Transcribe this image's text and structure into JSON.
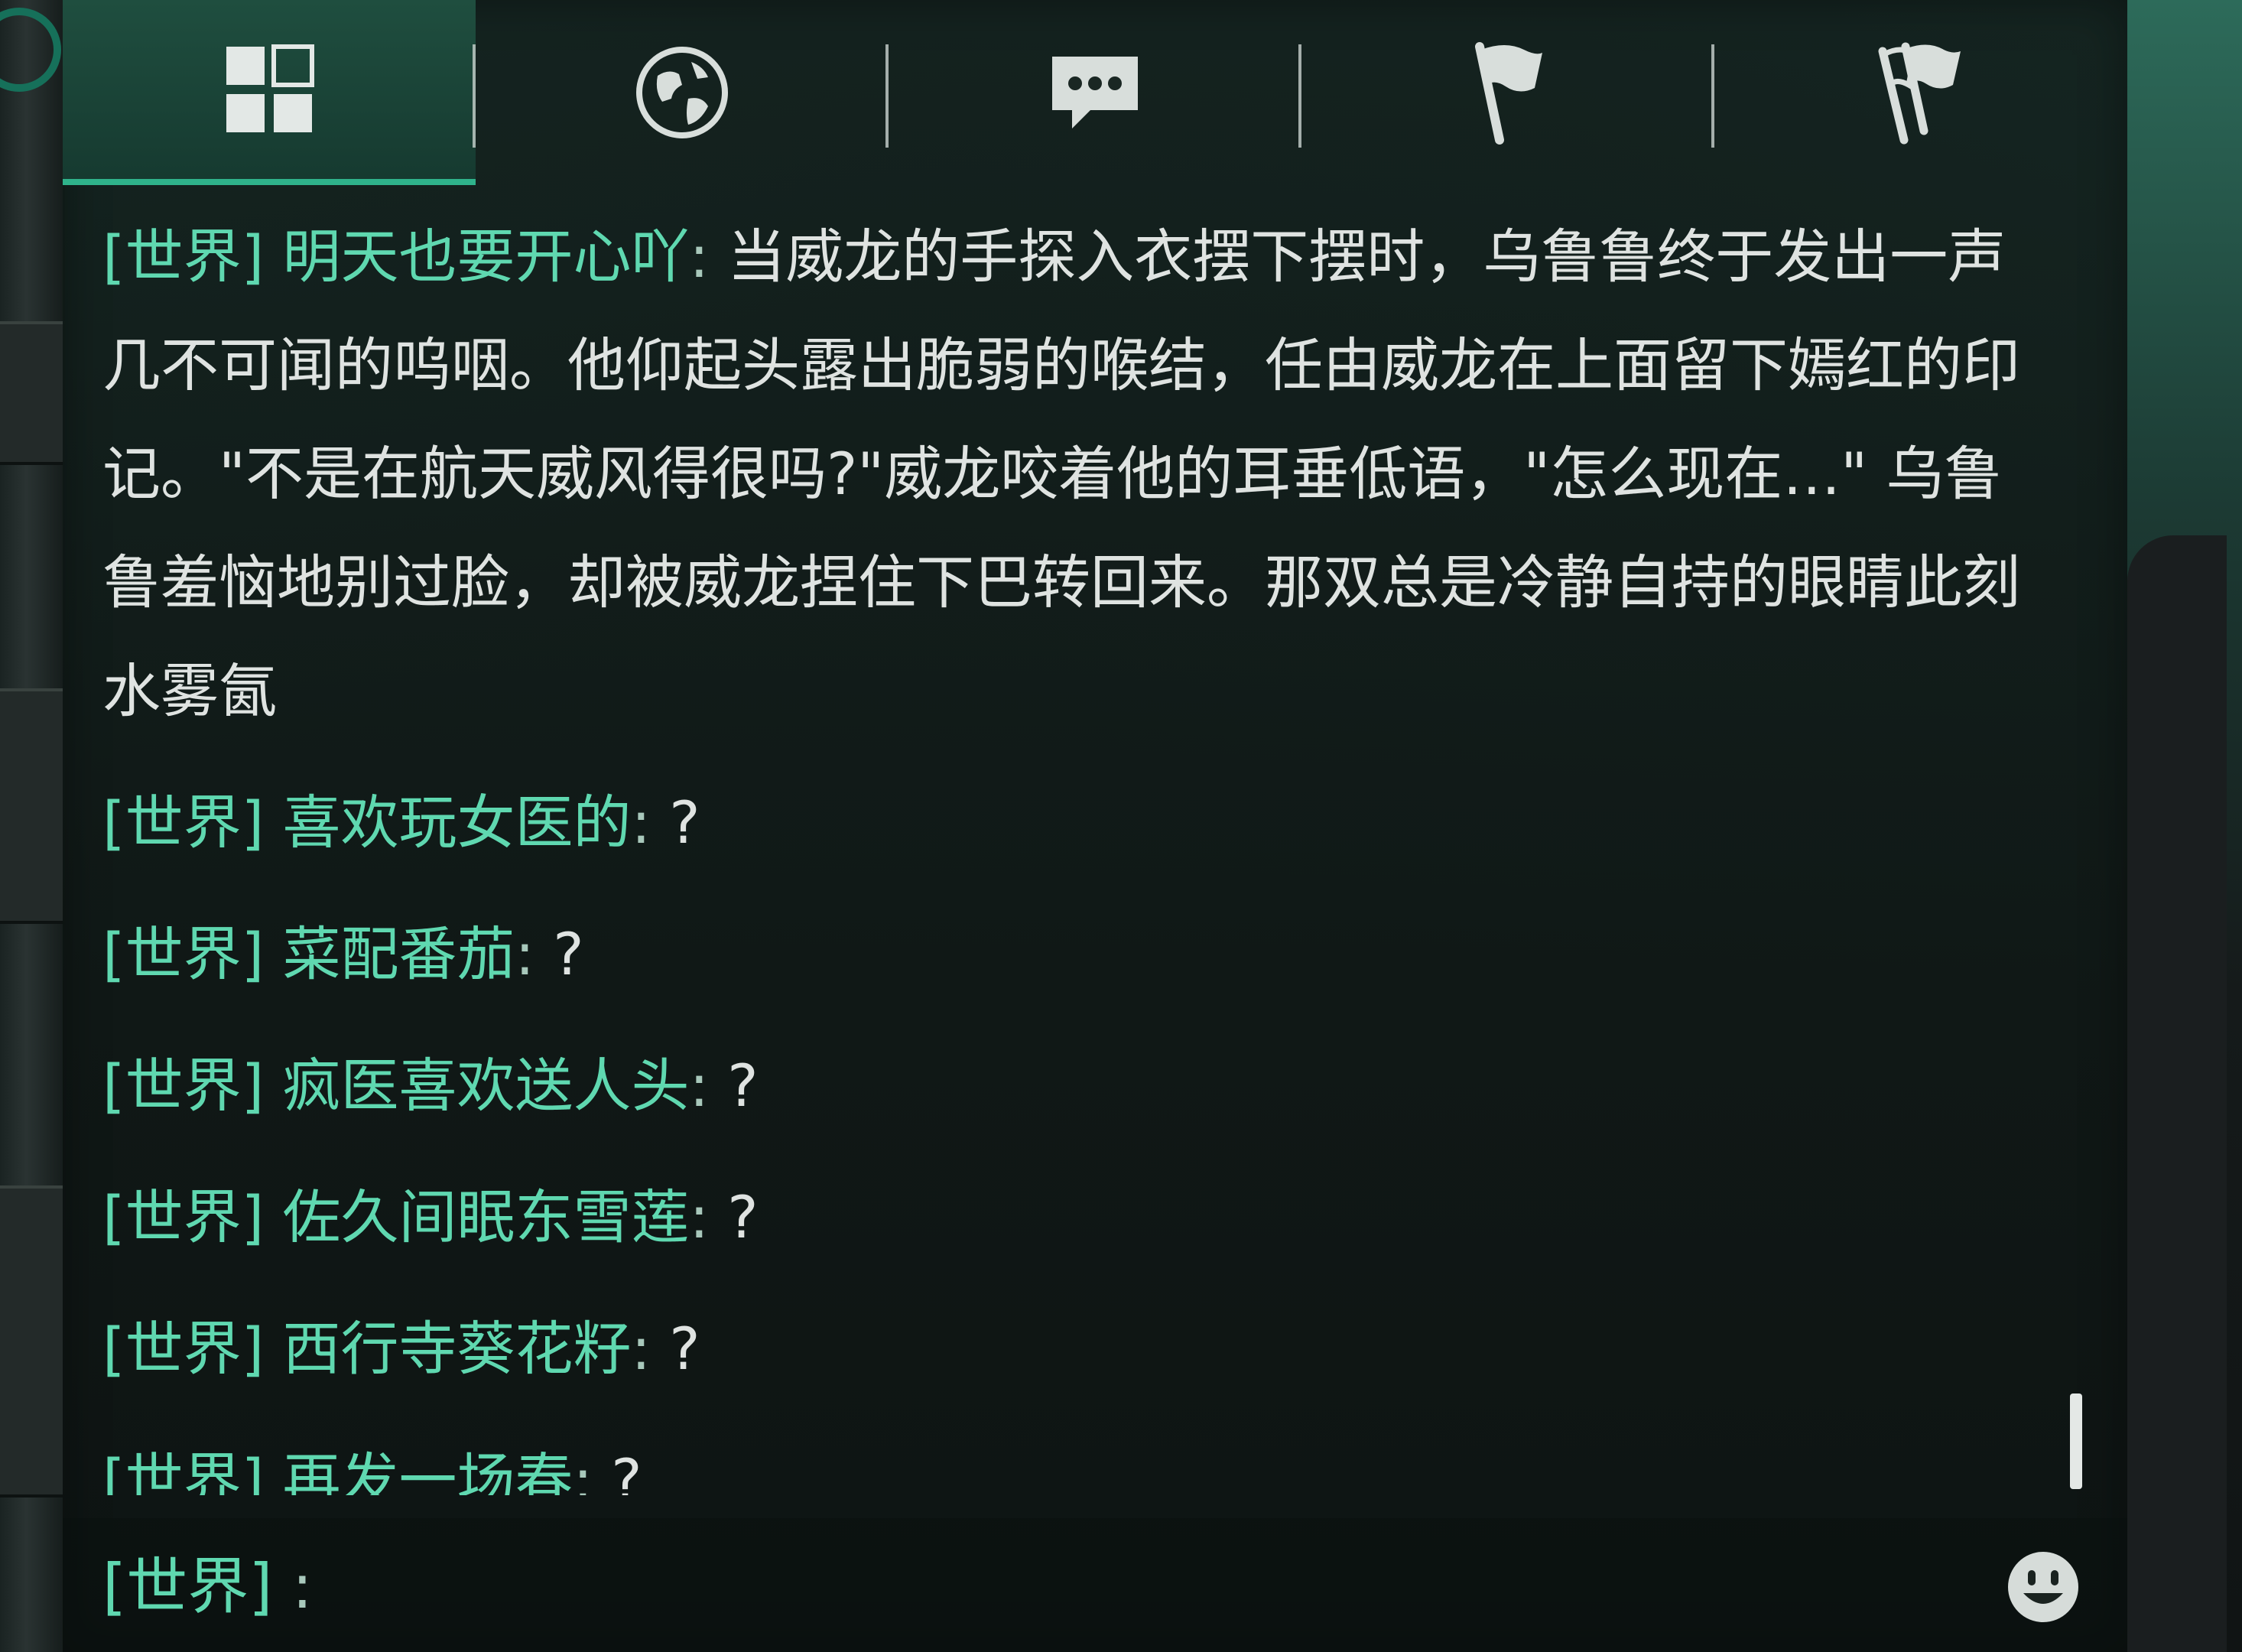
{
  "tabs": [
    {
      "id": "all",
      "icon": "grid-icon",
      "active": true
    },
    {
      "id": "world",
      "icon": "globe-icon",
      "active": false
    },
    {
      "id": "chat",
      "icon": "speech-bubble-icon",
      "active": false
    },
    {
      "id": "flag",
      "icon": "flag-icon",
      "active": false
    },
    {
      "id": "flags",
      "icon": "double-flag-icon",
      "active": false
    }
  ],
  "messages": [
    {
      "channel": "[世界]",
      "sender": "明天也要开心吖",
      "sep": ":",
      "text": "当威龙的手探入衣摆下摆时，乌鲁鲁终于发出一声几不可闻的呜咽。他仰起头露出脆弱的喉结，任由威龙在上面留下嫣红的印记。\"不是在航天威风得很吗?\"威龙咬着他的耳垂低语，\"怎么现在…\" 乌鲁鲁羞恼地别过脸，却被威龙捏住下巴转回来。那双总是冷静自持的眼睛此刻水雾氤"
    },
    {
      "channel": "[世界]",
      "sender": "喜欢玩女医的",
      "sep": ":",
      "text": "?"
    },
    {
      "channel": "[世界]",
      "sender": "菜配番茄",
      "sep": ":",
      "text": "?"
    },
    {
      "channel": "[世界]",
      "sender": "疯医喜欢送人头",
      "sep": ":",
      "text": "?"
    },
    {
      "channel": "[世界]",
      "sender": "佐久间眠东雪莲",
      "sep": ":",
      "text": "?"
    },
    {
      "channel": "[世界]",
      "sender": "西行寺葵花籽",
      "sep": ":",
      "text": "?"
    },
    {
      "channel": "[世界]",
      "sender": "再发一场春",
      "sep": ":",
      "text": "?"
    }
  ],
  "input": {
    "channel": "[世界]",
    "sep": ":",
    "value": ""
  },
  "emoji_button": {
    "icon": "smiley-face-icon"
  },
  "colors": {
    "accent": "#2fb38b",
    "channel_text": "#5fd8b0",
    "message_text": "#dfe3e1",
    "panel_bg": "#14221f"
  }
}
